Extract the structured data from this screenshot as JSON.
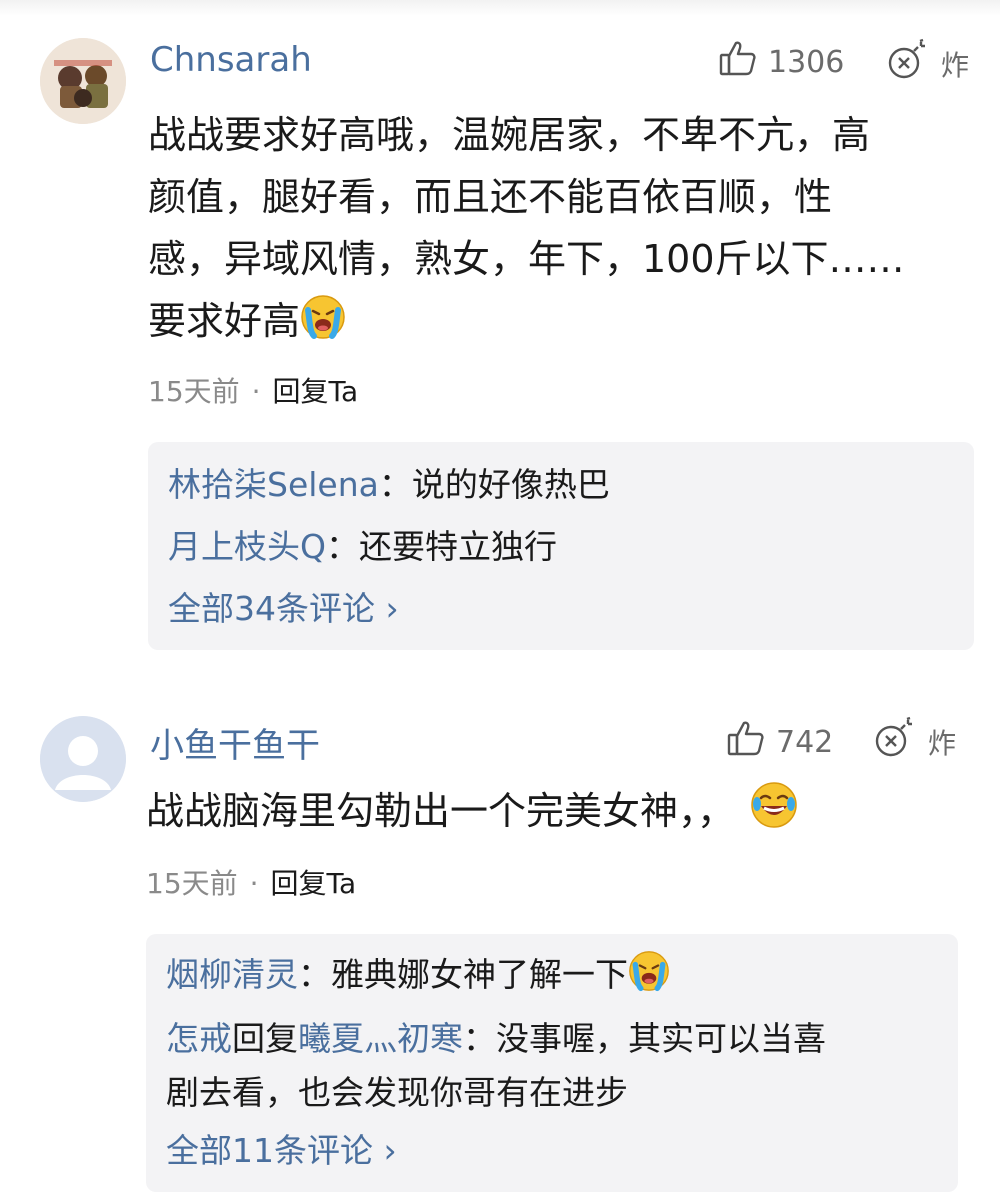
{
  "comments": [
    {
      "username": "Chnsarah",
      "like_count": "1306",
      "bomb_label": "炸",
      "text_lines": [
        "战战要求好高哦，温婉居家，不卑不亢，高",
        "颜值，腿好看，而且还不能百依百顺，性",
        "感，异域风情，熟女，年下，100斤以下……",
        "要求好高"
      ],
      "time": "15天前",
      "separator": "·",
      "reply_label": "回复Ta",
      "replies": [
        {
          "user": "林拾柒Selena",
          "colon": "：",
          "text": "说的好像热巴"
        },
        {
          "user": "月上枝头Q",
          "colon": "：",
          "text": "还要特立独行"
        }
      ],
      "more_label": "全部34条评论 ›"
    },
    {
      "username": "小鱼干鱼干",
      "like_count": "742",
      "bomb_label": "炸",
      "text_lines": [
        "战战脑海里勾勒出一个完美女神，，"
      ],
      "time": "15天前",
      "separator": "·",
      "reply_label": "回复Ta",
      "replies": [
        {
          "user": "烟柳清灵",
          "colon": "：",
          "text": "雅典娜女神了解一下"
        },
        {
          "user": "怎戒",
          "mid": "回复",
          "user2": "曦夏灬初寒",
          "colon": "：",
          "text": "没事喔，其实可以当喜",
          "text2": "剧去看，也会发现你哥有在进步"
        }
      ],
      "more_label": "全部11条评论 ›"
    }
  ],
  "icons": {
    "like": "thumbs-up-icon",
    "bomb": "bomb-icon",
    "emoji_cry": "crying-face-emoji",
    "emoji_laugh": "tears-of-joy-emoji"
  },
  "colors": {
    "username": "#4a6f9e",
    "meta": "#8a8a8a",
    "reply_bg": "#f3f3f5"
  }
}
